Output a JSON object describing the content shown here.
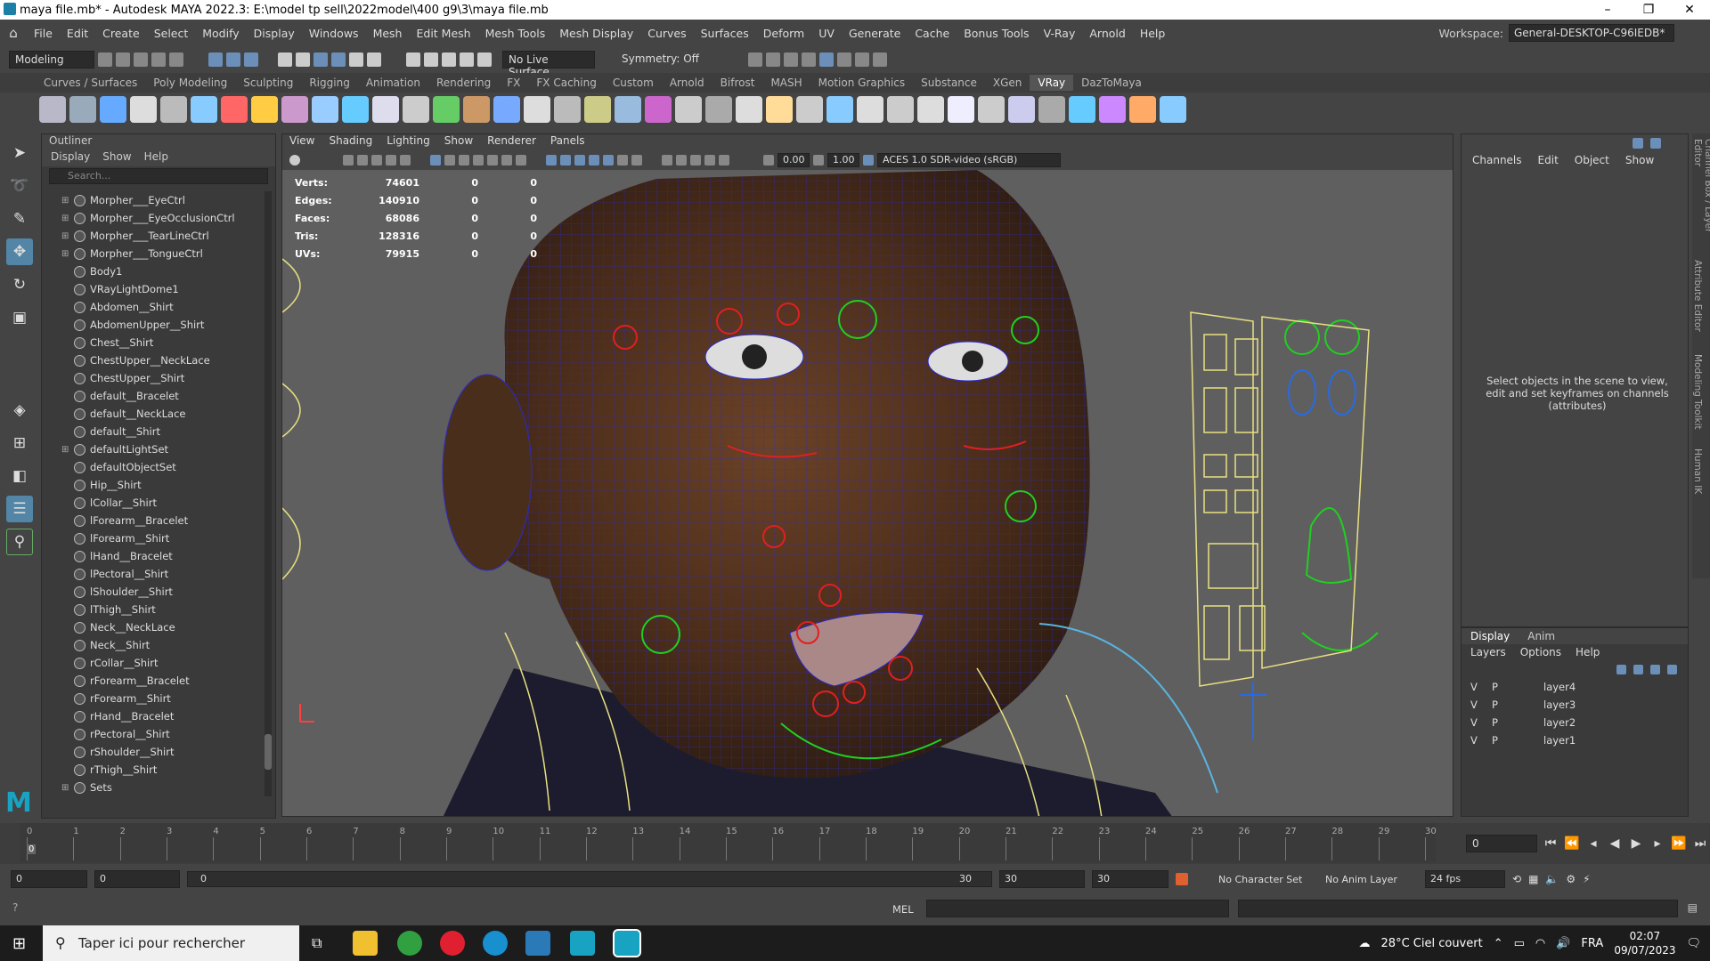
{
  "window": {
    "title": "maya file.mb* - Autodesk MAYA 2022.3: E:\\model tp sell\\2022model\\400 g9\\3\\maya file.mb"
  },
  "menubar": {
    "items": [
      "File",
      "Edit",
      "Create",
      "Select",
      "Modify",
      "Display",
      "Windows",
      "Mesh",
      "Edit Mesh",
      "Mesh Tools",
      "Mesh Display",
      "Curves",
      "Surfaces",
      "Deform",
      "UV",
      "Generate",
      "Cache",
      "Bonus Tools",
      "V-Ray",
      "Arnold",
      "Help"
    ],
    "workspace_label": "Workspace:",
    "workspace_value": "General-DESKTOP-C96IEDB*"
  },
  "statusline": {
    "mode": "Modeling",
    "live_surface": "No Live Surface",
    "symmetry": "Symmetry: Off"
  },
  "shelf": {
    "tabs": [
      "Curves / Surfaces",
      "Poly Modeling",
      "Sculpting",
      "Rigging",
      "Animation",
      "Rendering",
      "FX",
      "FX Caching",
      "Custom",
      "Arnold",
      "Bifrost",
      "MASH",
      "Motion Graphics",
      "Substance",
      "XGen",
      "VRay",
      "DazToMaya"
    ],
    "active_tab": "VRay"
  },
  "outliner": {
    "title": "Outliner",
    "menu": [
      "Display",
      "Show",
      "Help"
    ],
    "search_placeholder": "Search...",
    "items": [
      {
        "label": "Morpher___EyeCtrl",
        "expand": "⊞"
      },
      {
        "label": "Morpher___EyeOcclusionCtrl",
        "expand": "⊞"
      },
      {
        "label": "Morpher___TearLineCtrl",
        "expand": "⊞"
      },
      {
        "label": "Morpher___TongueCtrl",
        "expand": "⊞"
      },
      {
        "label": "Body1",
        "expand": ""
      },
      {
        "label": "VRayLightDome1",
        "expand": ""
      },
      {
        "label": "Abdomen__Shirt",
        "expand": ""
      },
      {
        "label": "AbdomenUpper__Shirt",
        "expand": ""
      },
      {
        "label": "Chest__Shirt",
        "expand": ""
      },
      {
        "label": "ChestUpper__NeckLace",
        "expand": ""
      },
      {
        "label": "ChestUpper__Shirt",
        "expand": ""
      },
      {
        "label": "default__Bracelet",
        "expand": ""
      },
      {
        "label": "default__NeckLace",
        "expand": ""
      },
      {
        "label": "default__Shirt",
        "expand": ""
      },
      {
        "label": "defaultLightSet",
        "expand": "⊞"
      },
      {
        "label": "defaultObjectSet",
        "expand": ""
      },
      {
        "label": "Hip__Shirt",
        "expand": ""
      },
      {
        "label": "lCollar__Shirt",
        "expand": ""
      },
      {
        "label": "lForearm__Bracelet",
        "expand": ""
      },
      {
        "label": "lForearm__Shirt",
        "expand": ""
      },
      {
        "label": "lHand__Bracelet",
        "expand": ""
      },
      {
        "label": "lPectoral__Shirt",
        "expand": ""
      },
      {
        "label": "lShoulder__Shirt",
        "expand": ""
      },
      {
        "label": "lThigh__Shirt",
        "expand": ""
      },
      {
        "label": "Neck__NeckLace",
        "expand": ""
      },
      {
        "label": "Neck__Shirt",
        "expand": ""
      },
      {
        "label": "rCollar__Shirt",
        "expand": ""
      },
      {
        "label": "rForearm__Bracelet",
        "expand": ""
      },
      {
        "label": "rForearm__Shirt",
        "expand": ""
      },
      {
        "label": "rHand__Bracelet",
        "expand": ""
      },
      {
        "label": "rPectoral__Shirt",
        "expand": ""
      },
      {
        "label": "rShoulder__Shirt",
        "expand": ""
      },
      {
        "label": "rThigh__Shirt",
        "expand": ""
      },
      {
        "label": "Sets",
        "expand": "⊞"
      }
    ]
  },
  "viewport": {
    "menu": [
      "View",
      "Shading",
      "Lighting",
      "Show",
      "Renderer",
      "Panels"
    ],
    "exposure": "0.00",
    "gamma": "1.00",
    "colorspace": "ACES 1.0 SDR-video (sRGB)",
    "hud": [
      {
        "label": "Verts:",
        "value": "74601",
        "a": "0",
        "b": "0"
      },
      {
        "label": "Edges:",
        "value": "140910",
        "a": "0",
        "b": "0"
      },
      {
        "label": "Faces:",
        "value": "68086",
        "a": "0",
        "b": "0"
      },
      {
        "label": "Tris:",
        "value": "128316",
        "a": "0",
        "b": "0"
      },
      {
        "label": "UVs:",
        "value": "79915",
        "a": "0",
        "b": "0"
      }
    ]
  },
  "channelbox": {
    "menu": [
      "Channels",
      "Edit",
      "Object",
      "Show"
    ],
    "hint": "Select objects in the scene to view, edit and set keyframes on channels (attributes)",
    "side_tabs": [
      "Channel Box / Layer Editor",
      "Attribute Editor",
      "Modeling Toolkit",
      "Human IK"
    ]
  },
  "layers": {
    "tabs": [
      "Display",
      "Anim"
    ],
    "menu": [
      "Layers",
      "Options",
      "Help"
    ],
    "rows": [
      {
        "v": "V",
        "p": "P",
        "name": "layer4"
      },
      {
        "v": "V",
        "p": "P",
        "name": "layer3"
      },
      {
        "v": "V",
        "p": "P",
        "name": "layer2"
      },
      {
        "v": "V",
        "p": "P",
        "name": "layer1"
      }
    ]
  },
  "timeline": {
    "ticks": [
      "0",
      "1",
      "2",
      "3",
      "4",
      "5",
      "6",
      "7",
      "8",
      "9",
      "10",
      "11",
      "12",
      "13",
      "14",
      "15",
      "16",
      "17",
      "18",
      "19",
      "20",
      "21",
      "22",
      "23",
      "24",
      "25",
      "26",
      "27",
      "28",
      "29",
      "30"
    ],
    "current_frame": "0",
    "current_frame_field": "0"
  },
  "range": {
    "start": "0",
    "anim_start": "0",
    "slider_start": "0",
    "slider_end": "30",
    "anim_end": "30",
    "end": "30",
    "character_set": "No Character Set",
    "anim_layer": "No Anim Layer",
    "fps": "24 fps"
  },
  "cmdline": {
    "lang": "MEL"
  },
  "taskbar": {
    "search": "Taper ici pour rechercher",
    "weather": "28°C  Ciel couvert",
    "lang": "FRA",
    "time": "02:07",
    "date": "09/07/2023"
  },
  "colors": {
    "accent": "#5285a6",
    "wire_blue": "#2a2acc",
    "ctrl_red": "#e02020",
    "ctrl_green": "#20d020",
    "ctrl_yellow": "#e8e080"
  }
}
